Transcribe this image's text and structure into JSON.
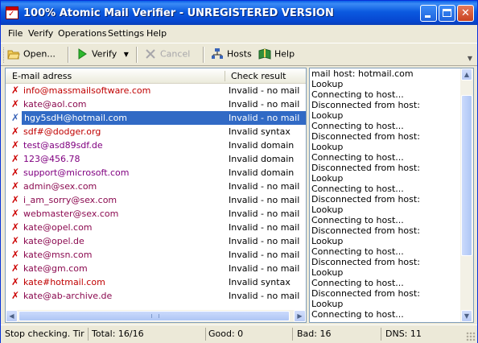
{
  "window": {
    "title": "100%  Atomic Mail Verifier - UNREGISTERED VERSION"
  },
  "menu": [
    "File",
    "Verify",
    "Operations",
    "Settings",
    "Help"
  ],
  "toolbar": {
    "open": "Open...",
    "verify": "Verify",
    "cancel": "Cancel",
    "hosts": "Hosts",
    "help": "Help"
  },
  "table": {
    "columns": [
      "E-mail adress",
      "Check result"
    ],
    "rows": [
      {
        "email": "info@massmailsoftware.com",
        "result": "Invalid - no mail"
      },
      {
        "email": "kate@aol.com",
        "result": "Invalid - no mail"
      },
      {
        "email": "hgy5sdH@hotmail.com",
        "result": "Invalid - no mail"
      },
      {
        "email": "sdf#@dodger.org",
        "result": "Invalid syntax"
      },
      {
        "email": "test@asd89sdf.de",
        "result": "Invalid domain"
      },
      {
        "email": "123@456.78",
        "result": "Invalid domain"
      },
      {
        "email": "support@microsoft.com",
        "result": "Invalid domain"
      },
      {
        "email": "admin@sex.com",
        "result": "Invalid - no mail"
      },
      {
        "email": "i_am_sorry@sex.com",
        "result": "Invalid - no mail"
      },
      {
        "email": "webmaster@sex.com",
        "result": "Invalid - no mail"
      },
      {
        "email": "kate@opel.com",
        "result": "Invalid - no mail"
      },
      {
        "email": "kate@opel.de",
        "result": "Invalid - no mail"
      },
      {
        "email": "kate@msn.com",
        "result": "Invalid - no mail"
      },
      {
        "email": "kate@gm.com",
        "result": "Invalid - no mail"
      },
      {
        "email": "kate#hotmail.com",
        "result": "Invalid syntax"
      },
      {
        "email": "kate@ab-archive.de",
        "result": "Invalid - no mail"
      }
    ]
  },
  "log": [
    "mail host: hotmail.com",
    "Lookup",
    "Connecting to host...",
    "Disconnected from host:",
    "Lookup",
    "Connecting to host...",
    "Disconnected from host:",
    "Lookup",
    "Connecting to host...",
    "Disconnected from host:",
    "Lookup",
    "Connecting to host...",
    "Disconnected from host:",
    "Lookup",
    "Connecting to host...",
    "Disconnected from host:",
    "Lookup",
    "Connecting to host...",
    "Disconnected from host:",
    "Lookup",
    "Connecting to host...",
    "Disconnected from host:",
    "Lookup",
    "Connecting to host..."
  ],
  "status": {
    "message": "Stop checking. Tir",
    "total": "Total: 16/16",
    "good": "Good: 0",
    "bad": "Bad: 16",
    "dns": "DNS: 11"
  }
}
